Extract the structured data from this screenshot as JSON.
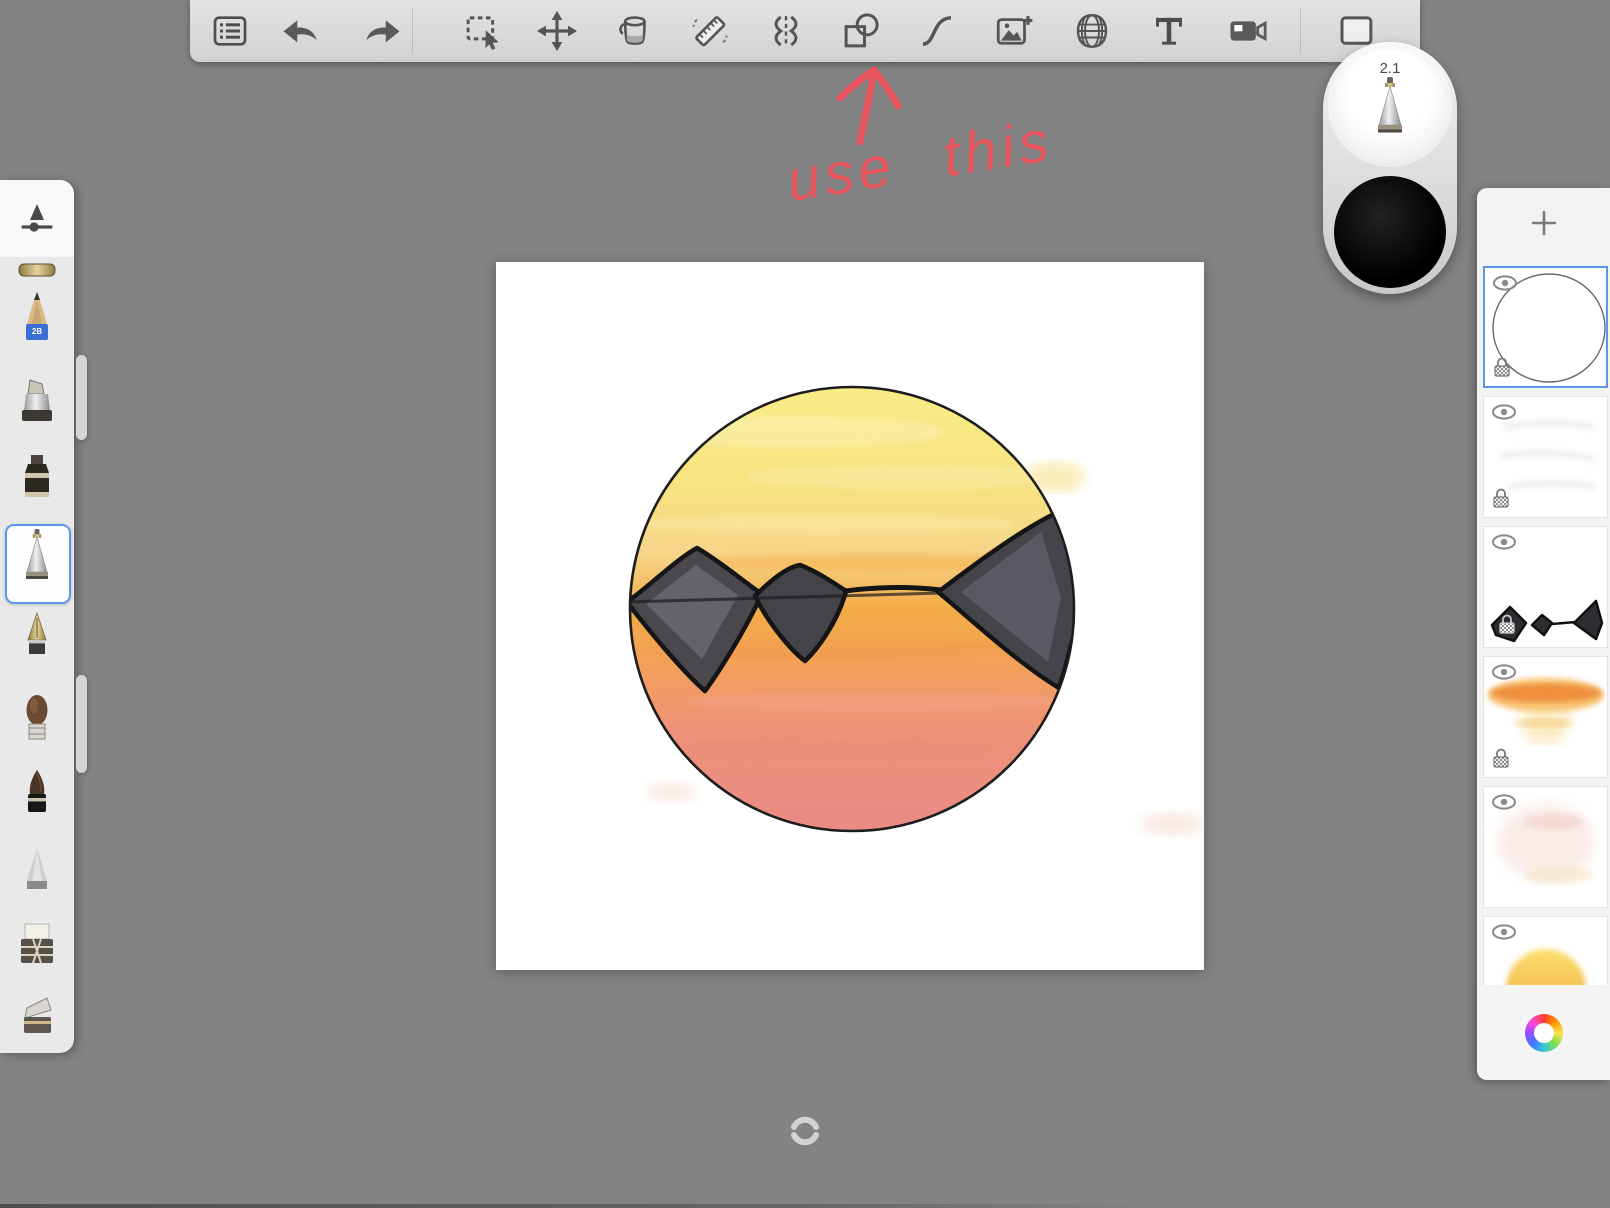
{
  "toolbar": {
    "icons": [
      "menu-icon",
      "undo-icon",
      "redo-icon",
      "selection-icon",
      "transform-icon",
      "fill-icon",
      "ruler-icon",
      "symmetry-icon",
      "shapes-icon",
      "stroke-icon",
      "import-image-icon",
      "perspective-icon",
      "text-icon",
      "timelapse-icon",
      "canvas-icon"
    ]
  },
  "puck": {
    "size_label": "2.1",
    "current_color": "#000000",
    "tool_icon": "pen-tip-icon"
  },
  "annotation": {
    "text": "use this",
    "color": "#e8555f",
    "arrow_icon": "up-arrow"
  },
  "left_toolbar": {
    "header_icon": "brush-settings-icon",
    "pencil_badge": "2B",
    "brushes": [
      "marker-gold",
      "pencil-2b",
      "chisel-marker",
      "ink-bottle",
      "technical-pen",
      "fountain-pen",
      "round-brush",
      "pointed-brush",
      "soft-gray-brush",
      "flat-eraser",
      "flat-brush"
    ],
    "selected_brush": "technical-pen"
  },
  "layers_panel": {
    "add_icon": "plus-icon",
    "color_wheel_icon": "color-wheel-icon",
    "layers": [
      {
        "thumbnail": "line-art-circle",
        "visible": true,
        "locked": true,
        "selected": true
      },
      {
        "thumbnail": "white-streaks",
        "visible": true,
        "locked": true,
        "selected": false
      },
      {
        "thumbnail": "mountains",
        "visible": true,
        "locked": true,
        "selected": false
      },
      {
        "thumbnail": "sunset-band",
        "visible": true,
        "locked": true,
        "selected": false
      },
      {
        "thumbnail": "pink-wash",
        "visible": true,
        "locked": false,
        "selected": false
      },
      {
        "thumbnail": "sun",
        "visible": true,
        "locked": false,
        "selected": false
      }
    ]
  },
  "canvas": {
    "rotate_icon": "rotate-canvas-icon",
    "artwork_colors": {
      "sky_top": "#f8e97d",
      "sky_mid": "#f3a645",
      "sky_bottom": "#ec8c82",
      "mountains": "#46454a",
      "outline": "#1d1d1d"
    }
  },
  "colors": {
    "background": "#838383",
    "toolbar": "#d9d9d9",
    "selection_blue": "#5b97e6",
    "annotation_red": "#e8555f"
  }
}
